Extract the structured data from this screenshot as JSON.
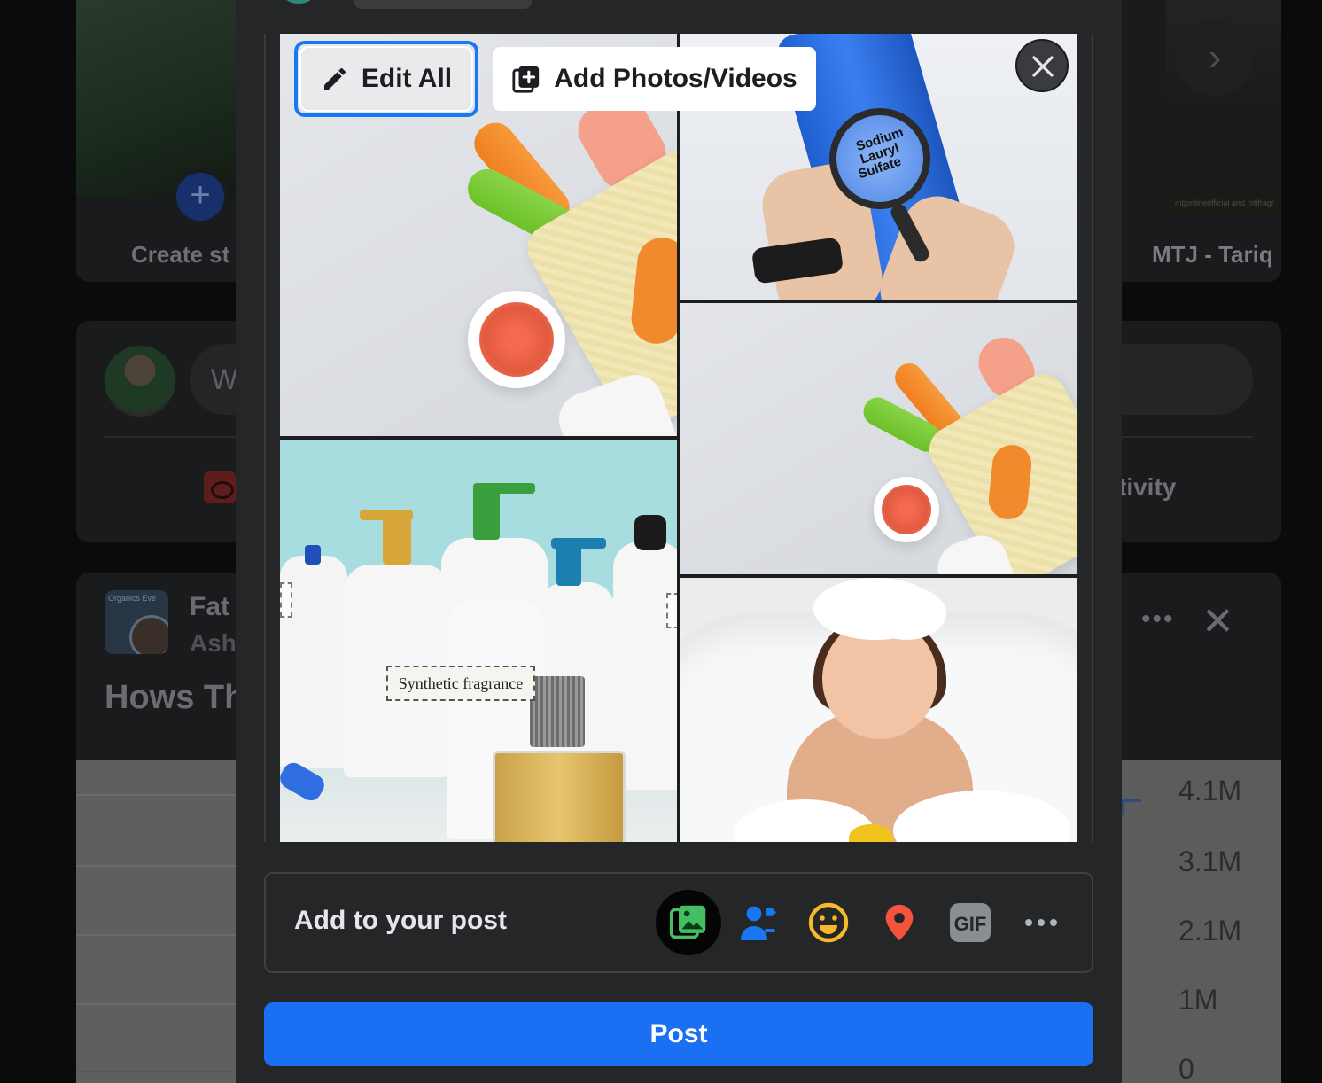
{
  "background": {
    "story_create_label": "Create st",
    "story_right_label": "MTJ - Tariq",
    "story_watermark": "mtjonlineofficial and mtjfragr",
    "composer_placeholder": "W",
    "activity_label": "tivity",
    "post_page_logo_text": "Organics Eve",
    "post_title": "Fat",
    "post_subtitle": "Ash",
    "post_heading": "Hows Th",
    "y_ticks": [
      "4.1M",
      "3.1M",
      "2.1M",
      "1M",
      "0"
    ]
  },
  "toolbar": {
    "edit_all_label": "Edit All",
    "edit_all_icon": "pencil-icon",
    "add_media_label": "Add Photos/Videos",
    "add_media_icon": "add-media-icon",
    "close_icon": "close-icon"
  },
  "photos": {
    "magnifier_text": [
      "Sodium",
      "Lauryl",
      "Sulfate"
    ],
    "fragrance_tag": "Synthetic fragrance"
  },
  "add_to_post": {
    "label": "Add to your post",
    "tools": [
      {
        "icon": "photo-video-icon",
        "active": true,
        "color": "#45bd62"
      },
      {
        "icon": "tag-people-icon",
        "active": false,
        "color": "#1877f2"
      },
      {
        "icon": "feeling-emoji-icon",
        "active": false,
        "color": "#f7b928"
      },
      {
        "icon": "location-pin-icon",
        "active": false,
        "color": "#f5533d"
      },
      {
        "icon": "gif-icon",
        "active": false,
        "color": "#8a8d91",
        "text": "GIF"
      },
      {
        "icon": "more-options-icon",
        "active": false,
        "color": "#b0b3b8"
      }
    ]
  },
  "post_button_label": "Post",
  "colors": {
    "accent": "#1877f2",
    "modal_bg": "#252627",
    "post_button": "#1b6ff2"
  }
}
